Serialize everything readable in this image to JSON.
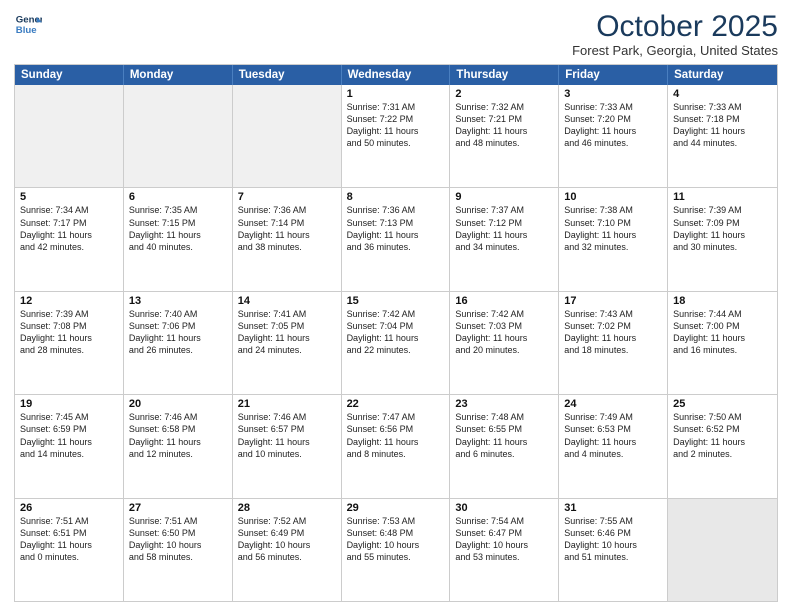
{
  "header": {
    "logo_line1": "General",
    "logo_line2": "Blue",
    "month_title": "October 2025",
    "location": "Forest Park, Georgia, United States"
  },
  "days_of_week": [
    "Sunday",
    "Monday",
    "Tuesday",
    "Wednesday",
    "Thursday",
    "Friday",
    "Saturday"
  ],
  "rows": [
    [
      {
        "day": "",
        "lines": [],
        "empty": true
      },
      {
        "day": "",
        "lines": [],
        "empty": true
      },
      {
        "day": "",
        "lines": [],
        "empty": true
      },
      {
        "day": "1",
        "lines": [
          "Sunrise: 7:31 AM",
          "Sunset: 7:22 PM",
          "Daylight: 11 hours",
          "and 50 minutes."
        ]
      },
      {
        "day": "2",
        "lines": [
          "Sunrise: 7:32 AM",
          "Sunset: 7:21 PM",
          "Daylight: 11 hours",
          "and 48 minutes."
        ]
      },
      {
        "day": "3",
        "lines": [
          "Sunrise: 7:33 AM",
          "Sunset: 7:20 PM",
          "Daylight: 11 hours",
          "and 46 minutes."
        ]
      },
      {
        "day": "4",
        "lines": [
          "Sunrise: 7:33 AM",
          "Sunset: 7:18 PM",
          "Daylight: 11 hours",
          "and 44 minutes."
        ]
      }
    ],
    [
      {
        "day": "5",
        "lines": [
          "Sunrise: 7:34 AM",
          "Sunset: 7:17 PM",
          "Daylight: 11 hours",
          "and 42 minutes."
        ]
      },
      {
        "day": "6",
        "lines": [
          "Sunrise: 7:35 AM",
          "Sunset: 7:15 PM",
          "Daylight: 11 hours",
          "and 40 minutes."
        ]
      },
      {
        "day": "7",
        "lines": [
          "Sunrise: 7:36 AM",
          "Sunset: 7:14 PM",
          "Daylight: 11 hours",
          "and 38 minutes."
        ]
      },
      {
        "day": "8",
        "lines": [
          "Sunrise: 7:36 AM",
          "Sunset: 7:13 PM",
          "Daylight: 11 hours",
          "and 36 minutes."
        ]
      },
      {
        "day": "9",
        "lines": [
          "Sunrise: 7:37 AM",
          "Sunset: 7:12 PM",
          "Daylight: 11 hours",
          "and 34 minutes."
        ]
      },
      {
        "day": "10",
        "lines": [
          "Sunrise: 7:38 AM",
          "Sunset: 7:10 PM",
          "Daylight: 11 hours",
          "and 32 minutes."
        ]
      },
      {
        "day": "11",
        "lines": [
          "Sunrise: 7:39 AM",
          "Sunset: 7:09 PM",
          "Daylight: 11 hours",
          "and 30 minutes."
        ]
      }
    ],
    [
      {
        "day": "12",
        "lines": [
          "Sunrise: 7:39 AM",
          "Sunset: 7:08 PM",
          "Daylight: 11 hours",
          "and 28 minutes."
        ]
      },
      {
        "day": "13",
        "lines": [
          "Sunrise: 7:40 AM",
          "Sunset: 7:06 PM",
          "Daylight: 11 hours",
          "and 26 minutes."
        ]
      },
      {
        "day": "14",
        "lines": [
          "Sunrise: 7:41 AM",
          "Sunset: 7:05 PM",
          "Daylight: 11 hours",
          "and 24 minutes."
        ]
      },
      {
        "day": "15",
        "lines": [
          "Sunrise: 7:42 AM",
          "Sunset: 7:04 PM",
          "Daylight: 11 hours",
          "and 22 minutes."
        ]
      },
      {
        "day": "16",
        "lines": [
          "Sunrise: 7:42 AM",
          "Sunset: 7:03 PM",
          "Daylight: 11 hours",
          "and 20 minutes."
        ]
      },
      {
        "day": "17",
        "lines": [
          "Sunrise: 7:43 AM",
          "Sunset: 7:02 PM",
          "Daylight: 11 hours",
          "and 18 minutes."
        ]
      },
      {
        "day": "18",
        "lines": [
          "Sunrise: 7:44 AM",
          "Sunset: 7:00 PM",
          "Daylight: 11 hours",
          "and 16 minutes."
        ]
      }
    ],
    [
      {
        "day": "19",
        "lines": [
          "Sunrise: 7:45 AM",
          "Sunset: 6:59 PM",
          "Daylight: 11 hours",
          "and 14 minutes."
        ]
      },
      {
        "day": "20",
        "lines": [
          "Sunrise: 7:46 AM",
          "Sunset: 6:58 PM",
          "Daylight: 11 hours",
          "and 12 minutes."
        ]
      },
      {
        "day": "21",
        "lines": [
          "Sunrise: 7:46 AM",
          "Sunset: 6:57 PM",
          "Daylight: 11 hours",
          "and 10 minutes."
        ]
      },
      {
        "day": "22",
        "lines": [
          "Sunrise: 7:47 AM",
          "Sunset: 6:56 PM",
          "Daylight: 11 hours",
          "and 8 minutes."
        ]
      },
      {
        "day": "23",
        "lines": [
          "Sunrise: 7:48 AM",
          "Sunset: 6:55 PM",
          "Daylight: 11 hours",
          "and 6 minutes."
        ]
      },
      {
        "day": "24",
        "lines": [
          "Sunrise: 7:49 AM",
          "Sunset: 6:53 PM",
          "Daylight: 11 hours",
          "and 4 minutes."
        ]
      },
      {
        "day": "25",
        "lines": [
          "Sunrise: 7:50 AM",
          "Sunset: 6:52 PM",
          "Daylight: 11 hours",
          "and 2 minutes."
        ]
      }
    ],
    [
      {
        "day": "26",
        "lines": [
          "Sunrise: 7:51 AM",
          "Sunset: 6:51 PM",
          "Daylight: 11 hours",
          "and 0 minutes."
        ]
      },
      {
        "day": "27",
        "lines": [
          "Sunrise: 7:51 AM",
          "Sunset: 6:50 PM",
          "Daylight: 10 hours",
          "and 58 minutes."
        ]
      },
      {
        "day": "28",
        "lines": [
          "Sunrise: 7:52 AM",
          "Sunset: 6:49 PM",
          "Daylight: 10 hours",
          "and 56 minutes."
        ]
      },
      {
        "day": "29",
        "lines": [
          "Sunrise: 7:53 AM",
          "Sunset: 6:48 PM",
          "Daylight: 10 hours",
          "and 55 minutes."
        ]
      },
      {
        "day": "30",
        "lines": [
          "Sunrise: 7:54 AM",
          "Sunset: 6:47 PM",
          "Daylight: 10 hours",
          "and 53 minutes."
        ]
      },
      {
        "day": "31",
        "lines": [
          "Sunrise: 7:55 AM",
          "Sunset: 6:46 PM",
          "Daylight: 10 hours",
          "and 51 minutes."
        ]
      },
      {
        "day": "",
        "lines": [],
        "empty": true,
        "shaded": true
      }
    ]
  ]
}
